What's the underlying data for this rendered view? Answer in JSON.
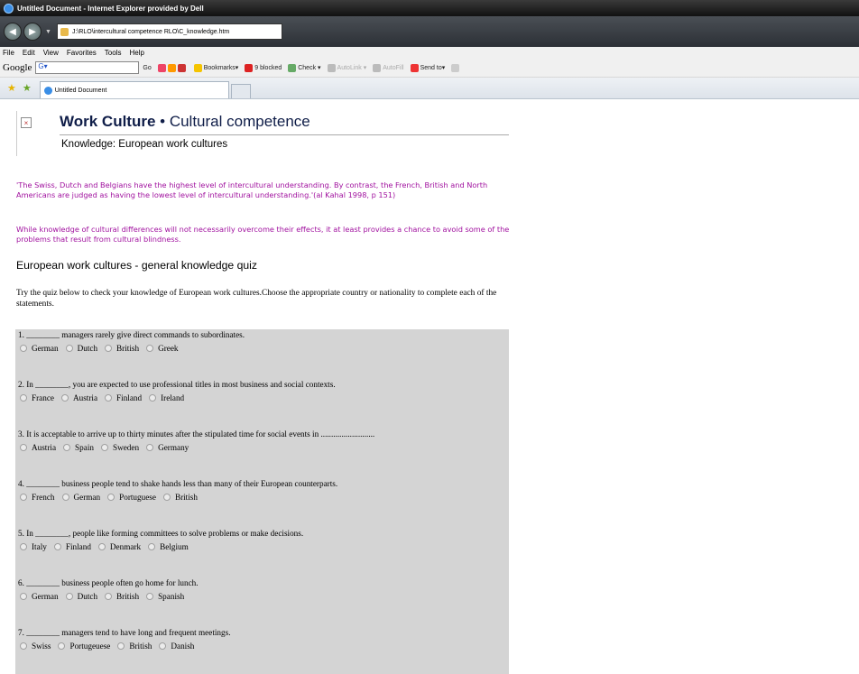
{
  "window": {
    "title": "Untitled Document - Internet Explorer provided by Dell",
    "address": "J:\\RLO\\intercultural competence RLO\\C_knowledge.htm"
  },
  "menu": [
    "File",
    "Edit",
    "View",
    "Favorites",
    "Tools",
    "Help"
  ],
  "google_toolbar": {
    "logo": "Google",
    "search_value": "G▾",
    "go_label": "Go",
    "bookmarks_label": "Bookmarks▾",
    "blocked_label": "9 blocked",
    "check_label": "Check ▾",
    "autolink_label": "AutoLink ▾",
    "autofill_label": "AutoFill",
    "sendto_label": "Send to▾"
  },
  "tab": {
    "label": "Untitled Document"
  },
  "page": {
    "title_strong": "Work Culture",
    "title_sep": " • ",
    "title_rest": "Cultural competence",
    "subtitle": "Knowledge: European work cultures",
    "quote_1": "'The Swiss, Dutch and Belgians have the highest level of intercultural understanding. By contrast, the French, British and North Americans are judged as having the lowest level of intercultural understanding.'(al Kahal 1998, p 151)",
    "quote_2": "While knowledge of cultural differences will not necessarily overcome their effects, it at least provides a chance to avoid some of the problems that result from cultural blindness.",
    "quiz_heading": "European work cultures - general knowledge quiz",
    "quiz_intro": "Try the quiz below to check your knowledge of European work cultures.Choose the appropriate country or nationality to complete each of the statements."
  },
  "questions": [
    {
      "text": "1. ________ managers rarely give direct commands to subordinates.",
      "options": [
        "German",
        "Dutch",
        "British",
        "Greek"
      ]
    },
    {
      "text": "2. In ________, you are expected to use professional titles in most business and social contexts.",
      "options": [
        "France",
        "Austria",
        "Finland",
        "Ireland"
      ]
    },
    {
      "text": "3. It is acceptable to arrive up to thirty minutes after the stipulated time for social events in ..........................",
      "options": [
        "Austria",
        "Spain",
        "Sweden",
        "Germany"
      ]
    },
    {
      "text": "4. ________ business people tend to shake hands less than many of their European counterparts.",
      "options": [
        "French",
        "German",
        "Portuguese",
        "British"
      ]
    },
    {
      "text": "5. In ________, people like forming committees to solve problems or make decisions.",
      "options": [
        "Italy",
        "Finland",
        "Denmark",
        "Belgium"
      ]
    },
    {
      "text": "6. ________ business people often go home for lunch.",
      "options": [
        "German",
        "Dutch",
        "British",
        "Spanish"
      ]
    },
    {
      "text": "7. ________ managers tend to have long and frequent meetings.",
      "options": [
        "Swiss",
        "Portugeuese",
        "British",
        "Danish"
      ]
    }
  ]
}
